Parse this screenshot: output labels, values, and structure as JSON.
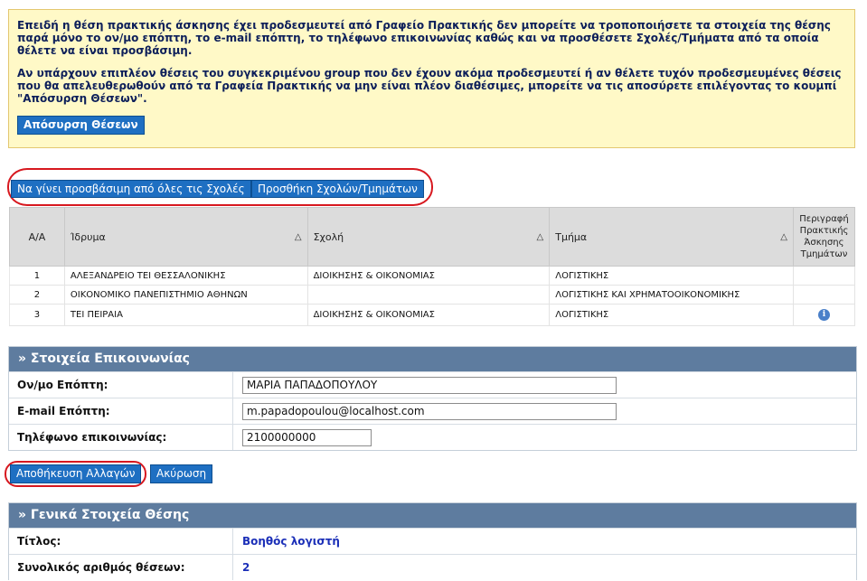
{
  "notice": {
    "paragraph1": "Επειδή η θέση πρακτικής άσκησης έχει προδεσμευτεί από Γραφείο Πρακτικής δεν μπορείτε να τροποποιήσετε τα στοιχεία της θέσης παρά μόνο το ον/μο επόπτη, το e-mail επόπτη, το τηλέφωνο επικοινωνίας καθώς και να προσθέσετε Σχολές/Τμήματα από τα οποία θέλετε να είναι προσβάσιμη.",
    "paragraph2": "Αν υπάρχουν επιπλέον θέσεις του συγκεκριμένου group που δεν έχουν ακόμα προδεσμευτεί ή αν θέλετε τυχόν προδεσμευμένες θέσεις που θα απελευθερωθούν από τα Γραφεία Πρακτικής να μην είναι πλέον διαθέσιμες, μπορείτε να τις αποσύρετε επιλέγοντας το κουμπί \"Απόσυρση Θέσεων\".",
    "withdraw_button": "Απόσυρση Θέσεων"
  },
  "access": {
    "all_schools_button": "Να γίνει προσβάσιμη από όλες τις Σχολές",
    "add_schools_button": "Προσθήκη Σχολών/Τμημάτων"
  },
  "grid": {
    "headers": {
      "aa": "Α/Α",
      "institution": "Ίδρυμα",
      "school": "Σχολή",
      "department": "Τμήμα",
      "description": "Περιγραφή Πρακτικής Άσκησης Τμημάτων"
    },
    "sort_glyph": "△",
    "rows": [
      {
        "aa": "1",
        "institution": "ΑΛΕΞΑΝΔΡΕΙΟ ΤΕΙ ΘΕΣΣΑΛΟΝΙΚΗΣ",
        "school": "ΔΙΟΙΚΗΣΗΣ & ΟΙΚΟΝΟΜΙΑΣ",
        "department": "ΛΟΓΙΣΤΙΚΗΣ"
      },
      {
        "aa": "2",
        "institution": "ΟΙΚΟΝΟΜΙΚΟ ΠΑΝΕΠΙΣΤΗΜΙΟ ΑΘΗΝΩΝ",
        "school": "",
        "department": "ΛΟΓΙΣΤΙΚΗΣ ΚΑΙ ΧΡΗΜΑΤΟΟΙΚΟΝΟΜΙΚΗΣ"
      },
      {
        "aa": "3",
        "institution": "ΤΕΙ ΠΕΙΡΑΙΑ",
        "school": "ΔΙΟΙΚΗΣΗΣ & ΟΙΚΟΝΟΜΙΑΣ",
        "department": "ΛΟΓΙΣΤΙΚΗΣ"
      }
    ],
    "info_glyph": "i"
  },
  "contact": {
    "title": "» Στοιχεία Επικοινωνίας",
    "supervisor_label": "Ον/μο Επόπτη:",
    "supervisor_value": "ΜΑΡΙΑ ΠΑΠΑΔΟΠΟΥΛΟΥ",
    "email_label": "E-mail Επόπτη:",
    "email_value": "m.papadopoulou@localhost.com",
    "phone_label": "Τηλέφωνο επικοινωνίας:",
    "phone_value": "2100000000"
  },
  "actions": {
    "save_button": "Αποθήκευση Αλλαγών",
    "cancel_button": "Ακύρωση"
  },
  "general": {
    "title": "» Γενικά Στοιχεία Θέσης",
    "title_label": "Τίτλος:",
    "title_value": "Βοηθός λογιστή",
    "positions_label": "Συνολικός αριθμός θέσεων:",
    "positions_value": "2"
  },
  "colors": {
    "accent_button": "#1e6fc2",
    "panel_header": "#5e7c9f",
    "notice_bg": "#fff9c7",
    "highlight": "#d7181f"
  }
}
